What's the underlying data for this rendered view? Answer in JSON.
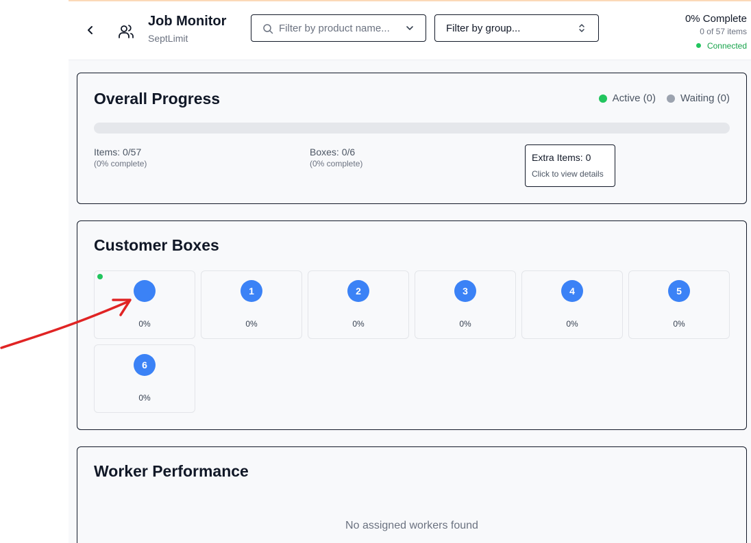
{
  "header": {
    "title": "Job Monitor",
    "subtitle": "SeptLimit",
    "product_filter_placeholder": "Filter by product name...",
    "group_filter_value": "Filter by group...",
    "status": {
      "complete_label": "0% Complete",
      "items_label": "0 of 57 items",
      "connection": "Connected",
      "connection_color": "#16a34a"
    },
    "icons": {
      "back": "chevron-left-icon",
      "people": "users-icon",
      "search": "search-icon",
      "dropdown": "chevron-down-icon",
      "updown": "chevrons-up-down-icon"
    }
  },
  "overall": {
    "title": "Overall Progress",
    "progress_fraction": 0,
    "legend": [
      {
        "label": "Active (0)",
        "color": "#22c55e"
      },
      {
        "label": "Waiting (0)",
        "color": "#9ca3af"
      }
    ],
    "items_label": "Items: 0/57",
    "items_sub": "(0% complete)",
    "boxes_label": "Boxes: 0/6",
    "boxes_sub": "(0% complete)",
    "extra_label": "Extra Items: 0",
    "extra_sub": "Click to view details"
  },
  "boxes": {
    "title": "Customer Boxes",
    "items": [
      {
        "number": "",
        "percent": "0%",
        "active": true
      },
      {
        "number": "1",
        "percent": "0%",
        "active": false
      },
      {
        "number": "2",
        "percent": "0%",
        "active": false
      },
      {
        "number": "3",
        "percent": "0%",
        "active": false
      },
      {
        "number": "4",
        "percent": "0%",
        "active": false
      },
      {
        "number": "5",
        "percent": "0%",
        "active": false
      },
      {
        "number": "6",
        "percent": "0%",
        "active": false
      }
    ],
    "circle_color": "#3b82f6"
  },
  "workers": {
    "title": "Worker Performance",
    "empty_message": "No assigned workers found"
  },
  "annotation": {
    "arrow_color": "#e02424"
  }
}
